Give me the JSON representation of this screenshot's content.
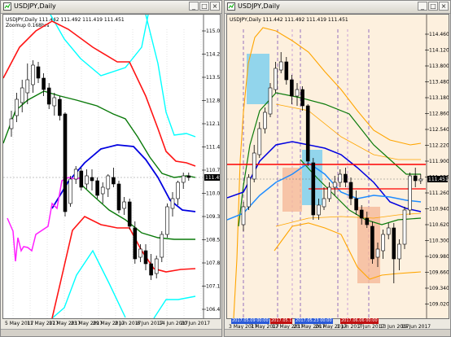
{
  "left_window": {
    "title": "USDJPY,Daily",
    "plot_header": "USDJPY,Daily  111.442 111.492 111.419 111.451",
    "plot_sub": "Zoomup 0.168hrs",
    "price_tag": "111.451",
    "y_labels": [
      "115.005",
      "114.290",
      "113.575",
      "112.880",
      "112.150",
      "111.445",
      "110.730",
      "110.015",
      "109.300",
      "108.580",
      "107.870",
      "107.150",
      "106.440"
    ],
    "x_labels": [
      "5 May 2017",
      "11 May 2017",
      "17 May 2017",
      "23 May 2017",
      "29 May 2017",
      "2 Jun 2017",
      "8 Jun 2017",
      "14 Jun 2017",
      "20 Jun 2017"
    ]
  },
  "right_window": {
    "title": "USDJPY,Daily",
    "plot_header": "USDJPY,Daily  111.442 111.492 111.419 111.451",
    "price_tag": "111.451",
    "y_labels": [
      "114.460",
      "114.120",
      "113.800",
      "113.480",
      "113.180",
      "112.860",
      "112.540",
      "112.220",
      "111.900",
      "111.580",
      "111.260",
      "110.940",
      "110.620",
      "110.300",
      "109.980",
      "109.660",
      "109.340",
      "109.020"
    ],
    "x_labels": [
      "3 May 2017",
      "7 May 2017",
      "17 May 2017",
      "23 May 2017",
      "26 May 2017",
      "1 Jun 2017",
      "7 Jun 2017",
      "13 Jun 2017",
      "19 Jun 2017"
    ],
    "x_tags": [
      "2017.05.09 00:00",
      "2017.05.1",
      "2017.05.23 00:00",
      "2017.06.06 00:00"
    ]
  },
  "window_buttons": {
    "minimize": "_",
    "maximize": "□",
    "close": "×"
  },
  "colors": {
    "right_bg": "#fdf0de",
    "bollinger_outer_left": "#ff1414",
    "bollinger_far_left": "#00ffff",
    "mid_green": "#0a7a0a",
    "ma_blue": "#0000e0",
    "magenta": "#ff20ff",
    "right_orange": "#ffa500",
    "right_red": "#ff0000",
    "right_blue": "#1e8cff",
    "right_lightblue": "#7fd0ee",
    "right_peach": "#f5b998"
  }
}
